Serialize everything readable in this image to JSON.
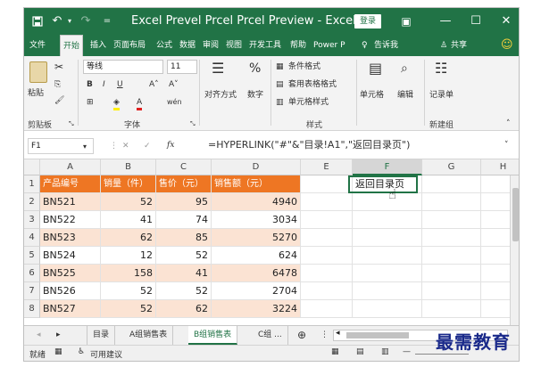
{
  "titlebar": {
    "save_icon": "save-icon",
    "undo_icon": "undo-icon",
    "title": "Excel Prevel Prcel Prcel Preview - Excel Preview",
    "login": "登录"
  },
  "tabs": [
    "文件",
    "开始",
    "插入",
    "页面布局",
    "公式",
    "数据",
    "审阅",
    "视图",
    "开发工具",
    "帮助",
    "Power P"
  ],
  "tell_me": "告诉我",
  "share": "共享",
  "ribbon": {
    "paste": "粘贴",
    "clipboard": "剪贴板",
    "font_name": "等线",
    "font_size": "11",
    "font_group": "字体",
    "align": "对齐方式",
    "number": "数字",
    "cond_format": "条件格式",
    "table_format": "套用表格格式",
    "cell_style": "单元格样式",
    "style_group": "样式",
    "cells": "单元格",
    "edit": "编辑",
    "record_macro": "记录单",
    "new_group": "新建组"
  },
  "formula_bar": {
    "namebox": "F1",
    "fx": "fx",
    "formula": "=HYPERLINK(\"#\"&\"目录!A1\",\"返回目录页\")"
  },
  "columns": [
    "A",
    "B",
    "C",
    "D",
    "E",
    "F",
    "G",
    "H"
  ],
  "rows": [
    "1",
    "2",
    "3",
    "4",
    "5",
    "6",
    "7",
    "8"
  ],
  "header_row": [
    "产品编号",
    "销量（件）",
    "售价（元）",
    "销售额（元）"
  ],
  "data_rows": [
    [
      "BN521",
      "52",
      "95",
      "4940"
    ],
    [
      "BN522",
      "41",
      "74",
      "3034"
    ],
    [
      "BN523",
      "62",
      "85",
      "5270"
    ],
    [
      "BN524",
      "12",
      "52",
      "624"
    ],
    [
      "BN525",
      "158",
      "41",
      "6478"
    ],
    [
      "BN526",
      "52",
      "52",
      "2704"
    ],
    [
      "BN527",
      "52",
      "62",
      "3224"
    ]
  ],
  "f1_value": "返回目录页",
  "sheets": [
    "目录",
    "A组销售表",
    "B组销售表",
    "C组 ..."
  ],
  "active_sheet_index": 2,
  "status": {
    "ready": "就绪",
    "accessibility": "可用建议"
  },
  "watermark": "最需教育",
  "colors": {
    "excel_green": "#217346",
    "header_orange": "#ee7623",
    "stripe": "#fbe3d3"
  }
}
